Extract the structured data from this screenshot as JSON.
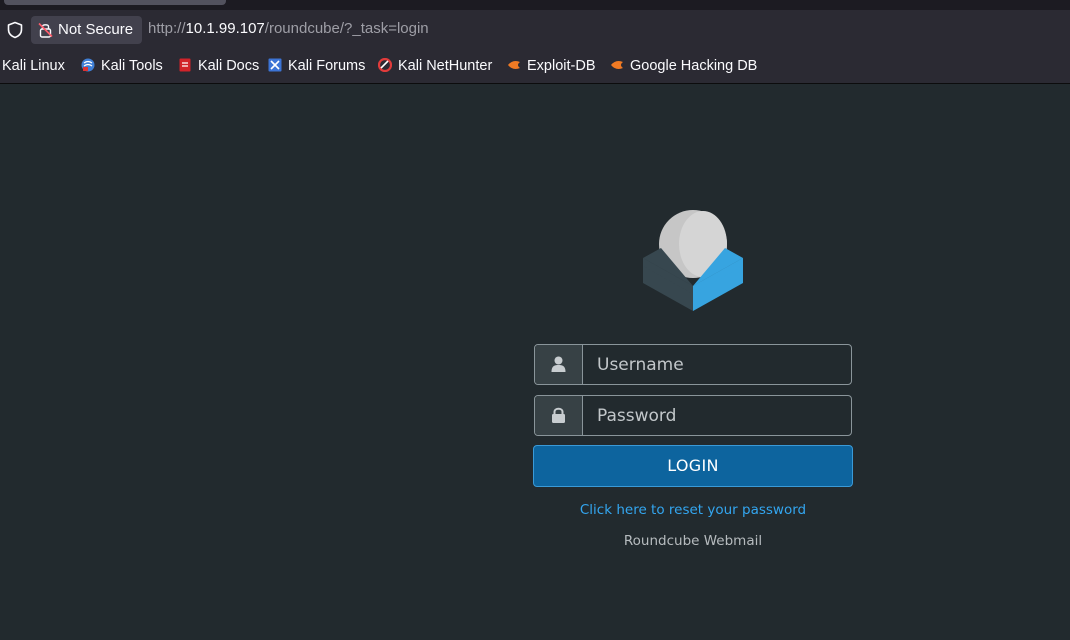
{
  "browser": {
    "security_label": "Not Secure",
    "url": {
      "scheme": "http://",
      "host": "10.1.99.107",
      "path": "/roundcube/?_task=login"
    },
    "bookmarks": [
      {
        "label": "Kali Linux",
        "icon": "kali-dragon-icon"
      },
      {
        "label": "Kali Tools",
        "icon": "kali-tools-icon"
      },
      {
        "label": "Kali Docs",
        "icon": "kali-docs-icon"
      },
      {
        "label": "Kali Forums",
        "icon": "kali-forums-icon"
      },
      {
        "label": "Kali NetHunter",
        "icon": "nethunter-icon"
      },
      {
        "label": "Exploit-DB",
        "icon": "exploit-db-icon"
      },
      {
        "label": "Google Hacking DB",
        "icon": "ghdb-icon"
      }
    ]
  },
  "login": {
    "username_placeholder": "Username",
    "password_placeholder": "Password",
    "username_value": "",
    "password_value": "",
    "submit_label": "LOGIN",
    "reset_link": "Click here to reset your password",
    "product_name": "Roundcube Webmail"
  },
  "colors": {
    "page_bg": "#222a2e",
    "accent": "#0d649e",
    "link": "#33a6f0"
  }
}
